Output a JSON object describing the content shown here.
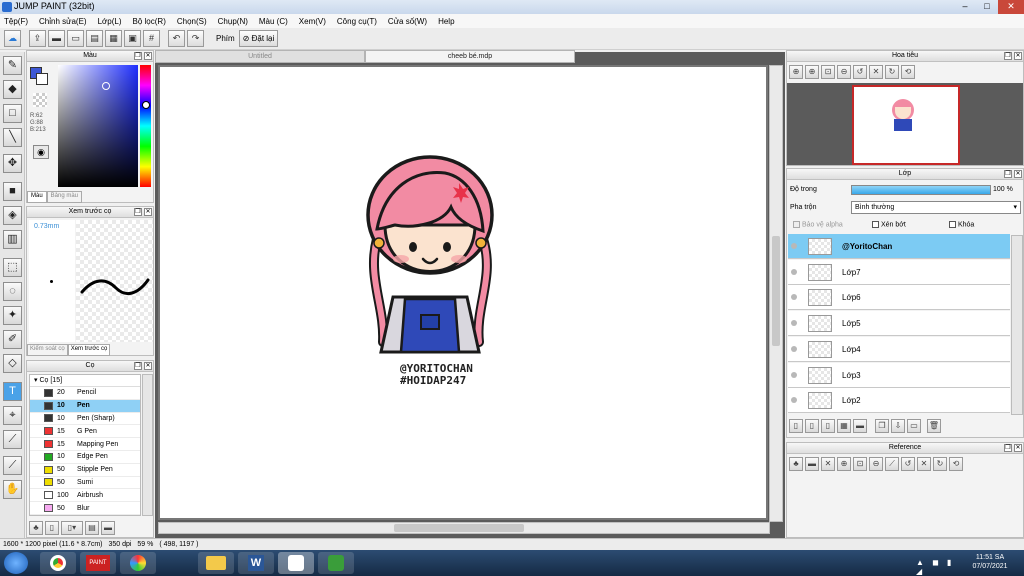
{
  "window": {
    "title": "JUMP PAINT (32bit)"
  },
  "menu": [
    "Tệp(F)",
    "Chỉnh sửa(E)",
    "Lớp(L)",
    "Bộ lọc(R)",
    "Chọn(S)",
    "Chụp(N)",
    "Màu (C)",
    "Xem(V)",
    "Công cụ(T)",
    "Cửa số(W)",
    "Help"
  ],
  "toolbar": {
    "phim_label": "Phím",
    "reset_label": "Đặt lại"
  },
  "color_panel": {
    "title": "Màu",
    "r": "R:62",
    "g": "G:88",
    "b": "B:213",
    "tab_color": "Màu",
    "tab_palette": "Bảng màu",
    "fg_color": "#3e58d5",
    "bg_color": "#ffffff"
  },
  "brush_preview": {
    "title": "Xem trước cọ",
    "size": "0.73mm",
    "tab_control": "Kiểm soát cọ",
    "tab_preview": "Xem trước cọ"
  },
  "brush_panel": {
    "title": "Cọ",
    "group": "Cọ [15]",
    "brushes": [
      {
        "size": "20",
        "name": "Pencil",
        "color": "#333333"
      },
      {
        "size": "10",
        "name": "Pen",
        "color": "#333333"
      },
      {
        "size": "10",
        "name": "Pen (Sharp)",
        "color": "#333333"
      },
      {
        "size": "15",
        "name": "G Pen",
        "color": "#ee3333"
      },
      {
        "size": "15",
        "name": "Mapping Pen",
        "color": "#ee3333"
      },
      {
        "size": "10",
        "name": "Edge Pen",
        "color": "#22aa22"
      },
      {
        "size": "50",
        "name": "Stipple Pen",
        "color": "#eedd00"
      },
      {
        "size": "50",
        "name": "Sumi",
        "color": "#eedd00"
      },
      {
        "size": "100",
        "name": "Airbrush",
        "color": "#ffffff"
      },
      {
        "size": "50",
        "name": "Blur",
        "color": "#f6aaf0"
      }
    ]
  },
  "tabs": {
    "tab1": "Untitled",
    "tab2": "cheeb bé.mdp"
  },
  "artwork": {
    "credit_line1": "@YORITOCHAN",
    "credit_line2": "#HOIDAP247"
  },
  "navigator": {
    "title": "Hoa tiêu"
  },
  "layers_panel": {
    "title": "Lớp",
    "opacity_label": "Độ trong",
    "opacity_value": "100 %",
    "opacity_percent": 100,
    "blend_label": "Pha trộn",
    "blend_value": "Bình thường",
    "protect_alpha": "Bảo vệ alpha",
    "clip": "Xén bớt",
    "lock": "Khóa",
    "layers": [
      "@YoritoChan",
      "Lớp7",
      "Lớp6",
      "Lớp5",
      "Lớp4",
      "Lớp3",
      "Lớp2"
    ]
  },
  "reference": {
    "title": "Reference"
  },
  "status": {
    "size": "1600 * 1200 pixel",
    "cm": "(11.6 * 8.7cm)",
    "dpi": "350 dpi",
    "zoom": "59 %",
    "coords": "( 498, 1197 )"
  },
  "taskbar": {
    "time": "11:51 SA",
    "date": "07/07/2021"
  }
}
